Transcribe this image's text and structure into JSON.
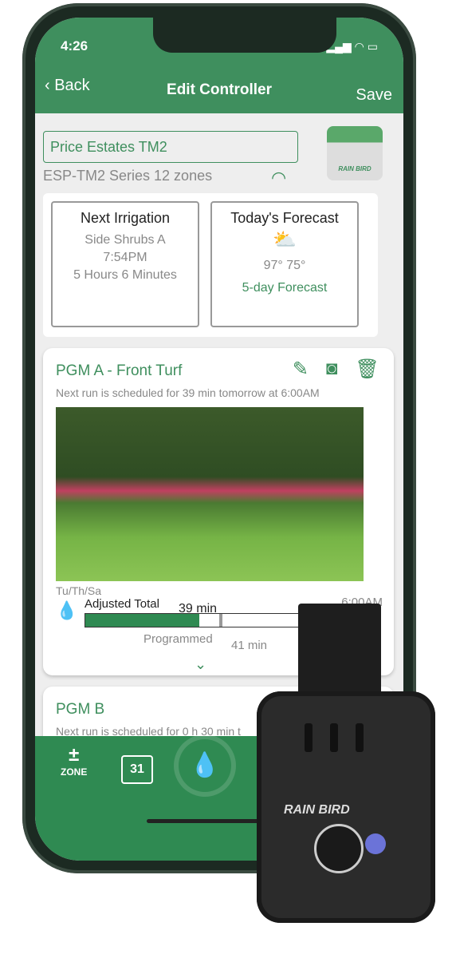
{
  "status_bar": {
    "time": "4:26",
    "icons": "signal wifi battery"
  },
  "header": {
    "back_label": "Back",
    "title": "Edit Controller",
    "save_label": "Save"
  },
  "controller": {
    "name": "Price Estates TM2",
    "series": "ESP-TM2 Series  12 zones",
    "brand": "RAIN BIRD"
  },
  "next_irrigation": {
    "title": "Next Irrigation",
    "zone": "Side Shrubs A",
    "time": "7:54PM",
    "remaining": "5 Hours 6 Minutes"
  },
  "forecast": {
    "title": "Today's Forecast",
    "icon": "partly-cloudy-icon",
    "temps": "97° 75°",
    "link": "5-day Forecast"
  },
  "programs": [
    {
      "name": "PGM A - Front Turf",
      "next_run": "Next run is scheduled for 39 min tomorrow at 6:00AM",
      "days": "Tu/Th/Sa",
      "start": "6:00AM",
      "adjusted_label": "Adjusted Total",
      "adjusted_value": "39 min",
      "programmed_label": "Programmed",
      "programmed_value": "41 min",
      "adjusted_fraction": 0.48
    },
    {
      "name": "PGM B",
      "next_run": "Next run is scheduled for 0 h 30 min t"
    }
  ],
  "tabbar": {
    "zone_label": "ZONE",
    "calendar_day": "31"
  },
  "device": {
    "brand": "RAIN BIRD"
  },
  "colors": {
    "brand_green": "#3f8f5e",
    "dark_green": "#2f8a52",
    "led": "#6b73d8"
  }
}
